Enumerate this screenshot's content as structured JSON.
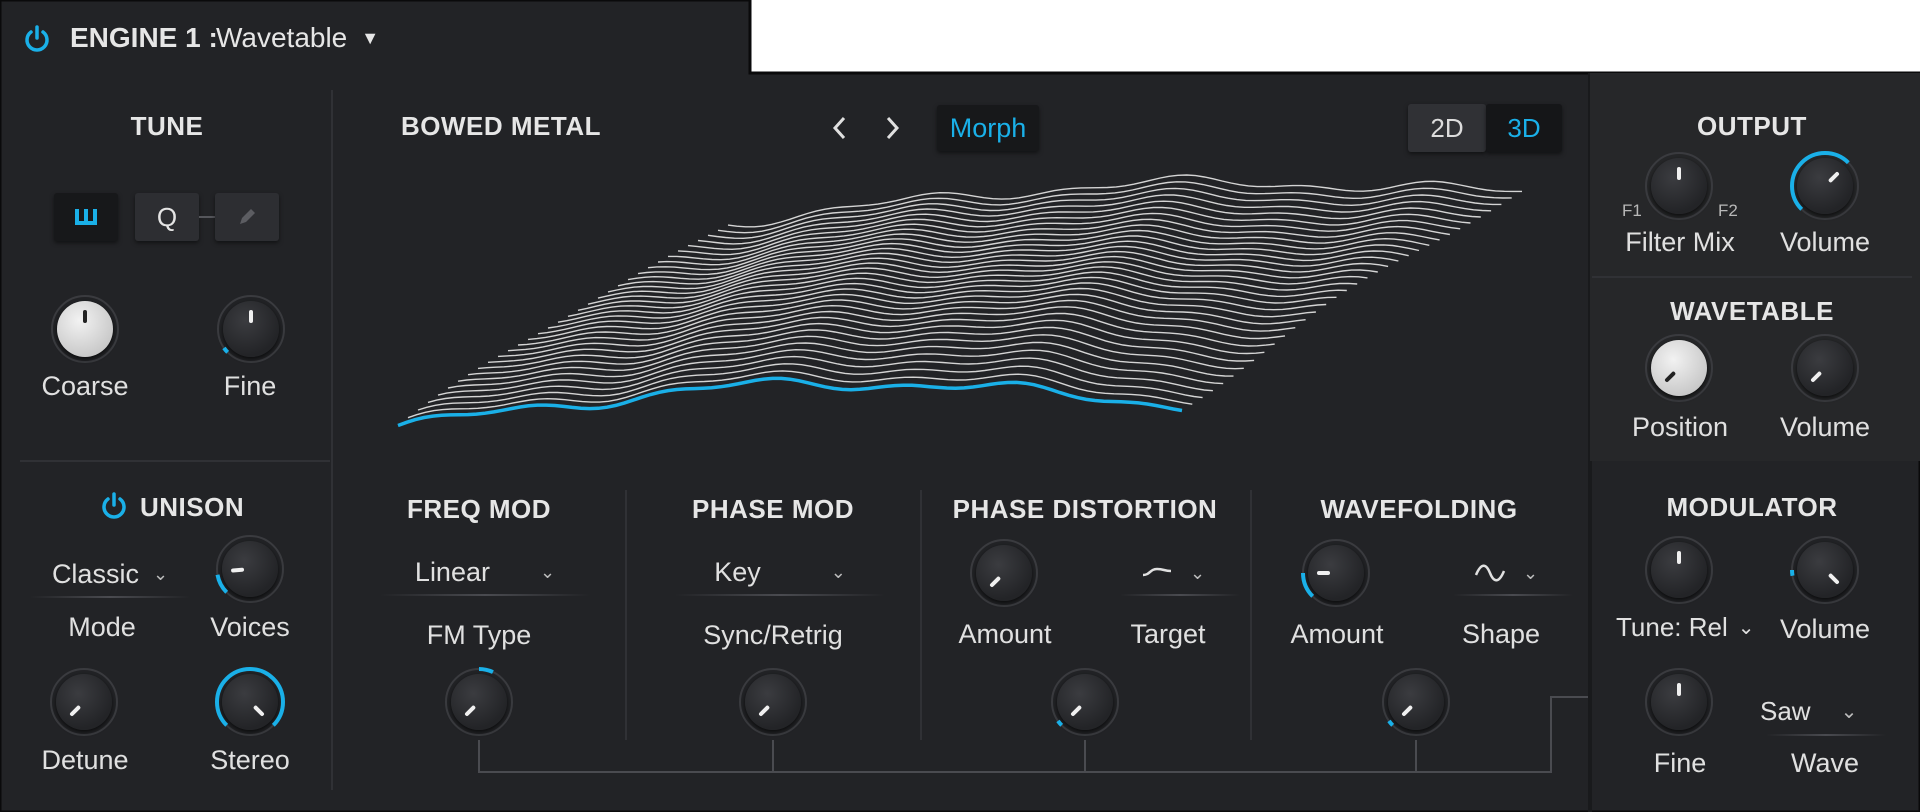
{
  "header": {
    "engine_label": "ENGINE 1 :",
    "engine_type": "Wavetable"
  },
  "tune": {
    "title": "TUNE",
    "q_label": "Q",
    "coarse": "Coarse",
    "fine": "Fine"
  },
  "unison": {
    "title": "UNISON",
    "mode_value": "Classic",
    "mode_label": "Mode",
    "voices": "Voices",
    "detune": "Detune",
    "stereo": "Stereo"
  },
  "display": {
    "wavetable_name": "BOWED METAL",
    "morph": "Morph",
    "view_2d": "2D",
    "view_3d": "3D",
    "active_view": "3D"
  },
  "output": {
    "title": "OUTPUT",
    "f1": "F1",
    "f2": "F2",
    "filter_mix": "Filter Mix",
    "volume": "Volume"
  },
  "wavetable": {
    "title": "WAVETABLE",
    "position": "Position",
    "volume": "Volume"
  },
  "freq_mod": {
    "title": "FREQ MOD",
    "type_value": "Linear",
    "type_label": "FM Type"
  },
  "phase_mod": {
    "title": "PHASE MOD",
    "value": "Key",
    "label": "Sync/Retrig"
  },
  "phase_distortion": {
    "title": "PHASE DISTORTION",
    "amount": "Amount",
    "target": "Target"
  },
  "wavefolding": {
    "title": "WAVEFOLDING",
    "amount": "Amount",
    "shape": "Shape"
  },
  "modulator": {
    "title": "MODULATOR",
    "tune_value": "Tune: Rel",
    "volume": "Volume",
    "fine": "Fine",
    "wave_value": "Saw",
    "wave_label": "Wave"
  },
  "colors": {
    "accent": "#1ab0e8",
    "background": "#232427",
    "panel_border": "#0d0d0e"
  }
}
